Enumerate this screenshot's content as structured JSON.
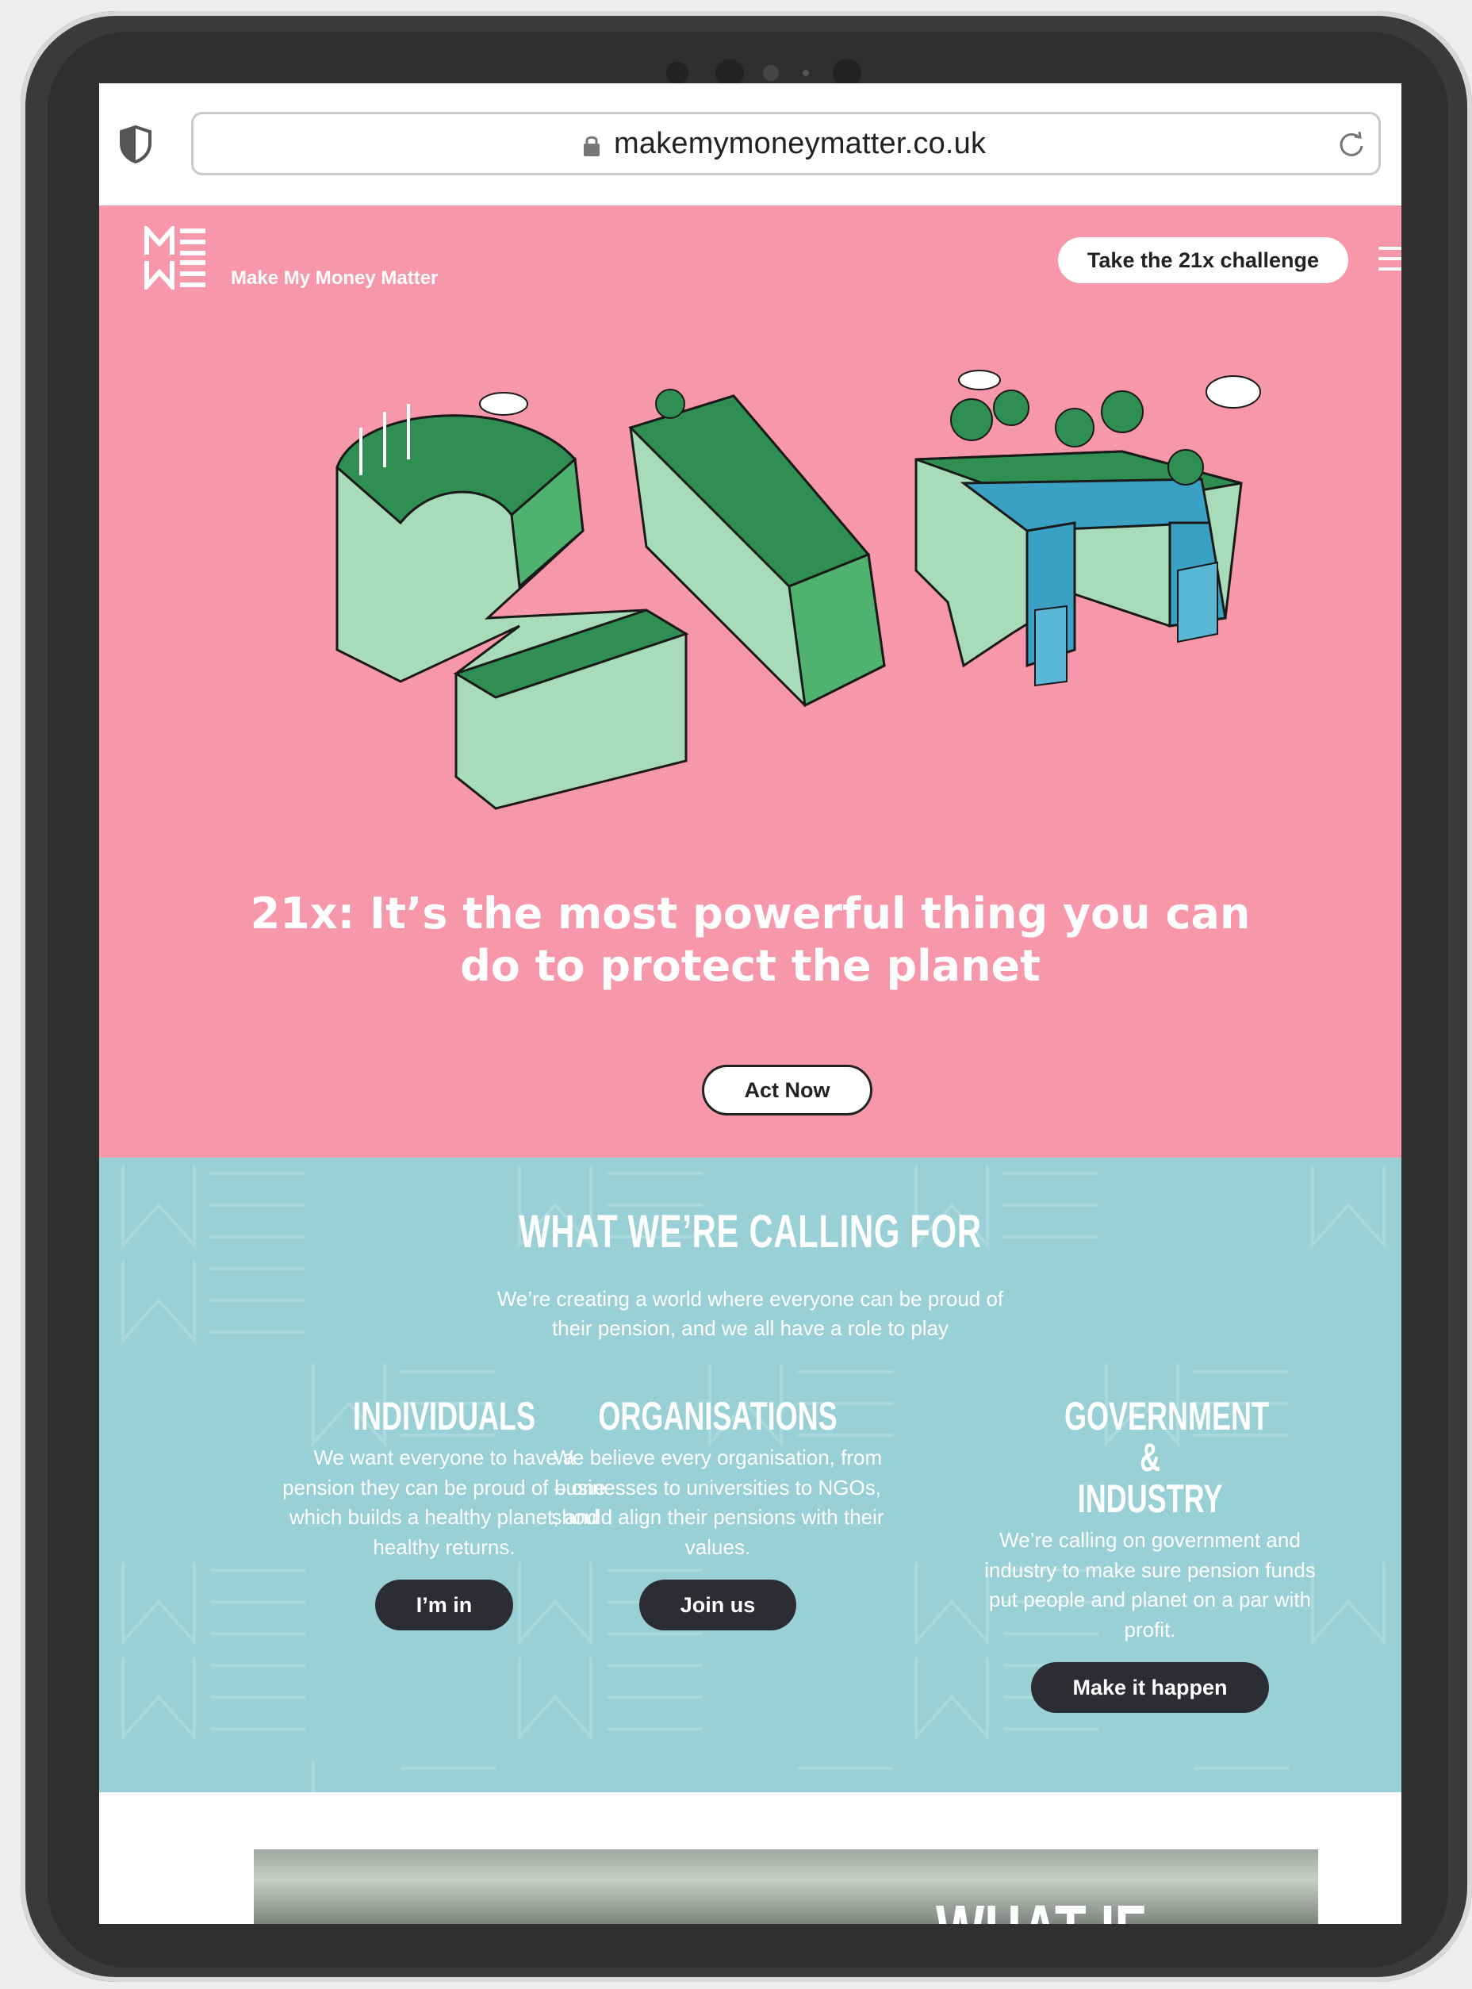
{
  "browser": {
    "url": "makemymoneymatter.co.uk"
  },
  "header": {
    "brand_name": "Make My Money Matter",
    "challenge_button": "Take the 21x challenge"
  },
  "hero": {
    "illustration_text": "21x",
    "title": "21x: It’s the most powerful thing you can do to protect the planet",
    "cta": "Act Now",
    "background": "#f797aa"
  },
  "calling_for": {
    "title": "WHAT WE’RE CALLING FOR",
    "subtitle": "We’re creating a world where everyone can be proud of their pension, and we all have a role to play",
    "background": "#98d0d6",
    "columns": [
      {
        "title": "INDIVIDUALS",
        "text": "We want everyone to have a pension they can be proud of – one which builds a healthy planet, and healthy returns.",
        "button": "I’m in"
      },
      {
        "title": "ORGANISATIONS",
        "text": "We believe every organisation, from businesses to universities to NGOs, should align their pensions with their values.",
        "button": "Join us"
      },
      {
        "title": "GOVERNMENT & INDUSTRY",
        "text": "We’re calling on government and industry to make sure pension funds put people and planet on a par with profit.",
        "button": "Make it happen"
      }
    ]
  },
  "bottom": {
    "photo_text": "WHAT IF"
  },
  "icons": [
    "shield-icon",
    "lock-icon",
    "reload-icon",
    "logo-icon",
    "hamburger-menu-icon"
  ]
}
